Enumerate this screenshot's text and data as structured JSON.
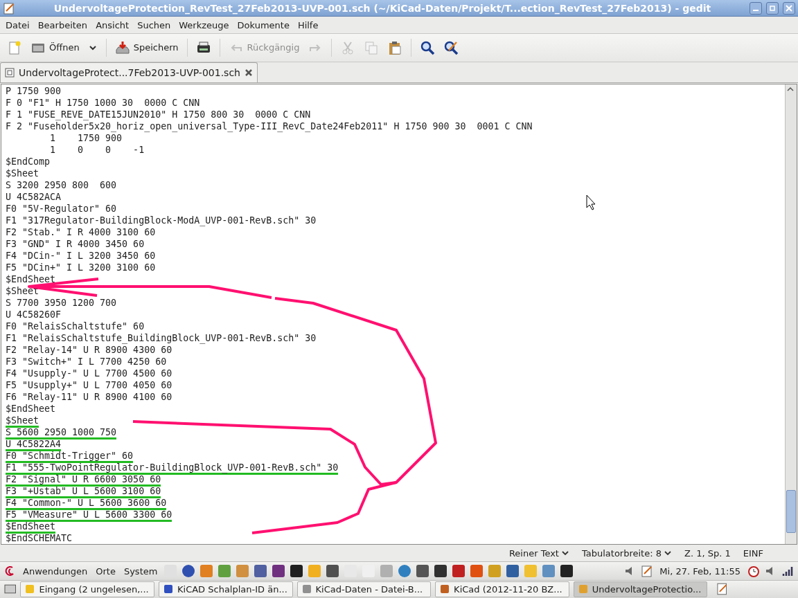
{
  "window": {
    "title": "UndervoltageProtection_RevTest_27Feb2013-UVP-001.sch (~/KiCad-Daten/Projekt/T...ection_RevTest_27Feb2013) - gedit"
  },
  "menu": [
    "Datei",
    "Bearbeiten",
    "Ansicht",
    "Suchen",
    "Werkzeuge",
    "Dokumente",
    "Hilfe"
  ],
  "toolbar": [
    {
      "kind": "new",
      "disabled": false
    },
    {
      "kind": "open",
      "label": "Öffnen",
      "disabled": false
    },
    {
      "kind": "dropdown",
      "disabled": false
    },
    {
      "kind": "sep"
    },
    {
      "kind": "save",
      "label": "Speichern",
      "disabled": false
    },
    {
      "kind": "sep"
    },
    {
      "kind": "print",
      "disabled": false
    },
    {
      "kind": "sep"
    },
    {
      "kind": "undo",
      "label": "Rückgängig",
      "disabled": true
    },
    {
      "kind": "redo",
      "disabled": true
    },
    {
      "kind": "sep"
    },
    {
      "kind": "cut",
      "disabled": true
    },
    {
      "kind": "copy",
      "disabled": true
    },
    {
      "kind": "paste",
      "disabled": false
    },
    {
      "kind": "sep"
    },
    {
      "kind": "search",
      "disabled": false
    },
    {
      "kind": "replace",
      "disabled": false
    }
  ],
  "tabs": [
    {
      "label": "UndervoltageProtect...7Feb2013-UVP-001.sch",
      "selected": true
    }
  ],
  "lines": [
    {
      "text": "P 1750 900",
      "underlined": false
    },
    {
      "text": "F 0 \"F1\" H 1750 1000 30  0000 C CNN",
      "underlined": false
    },
    {
      "text": "F 1 \"FUSE_REVE_DATE15JUN2010\" H 1750 800 30  0000 C CNN",
      "underlined": false
    },
    {
      "text": "F 2 \"Fuseholder5x20_horiz_open_universal_Type-III_RevC_Date24Feb2011\" H 1750 900 30  0001 C CNN",
      "underlined": false
    },
    {
      "text": "        1    1750 900",
      "underlined": false
    },
    {
      "text": "        1    0    0    -1",
      "underlined": false
    },
    {
      "text": "$EndComp",
      "underlined": false
    },
    {
      "text": "$Sheet",
      "underlined": false
    },
    {
      "text": "S 3200 2950 800  600",
      "underlined": false
    },
    {
      "text": "U 4C582ACA",
      "underlined": false
    },
    {
      "text": "F0 \"5V-Regulator\" 60",
      "underlined": false
    },
    {
      "text": "F1 \"317Regulator-BuildingBlock-ModA_UVP-001-RevB.sch\" 30",
      "underlined": false
    },
    {
      "text": "F2 \"Stab.\" I R 4000 3100 60",
      "underlined": false
    },
    {
      "text": "F3 \"GND\" I R 4000 3450 60",
      "underlined": false
    },
    {
      "text": "F4 \"DCin-\" I L 3200 3450 60",
      "underlined": false
    },
    {
      "text": "F5 \"DCin+\" I L 3200 3100 60",
      "underlined": false
    },
    {
      "text": "$EndSheet",
      "underlined": false
    },
    {
      "text": "$Sheet",
      "underlined": false
    },
    {
      "text": "S 7700 3950 1200 700",
      "underlined": false
    },
    {
      "text": "U 4C58260F",
      "underlined": false
    },
    {
      "text": "F0 \"RelaisSchaltstufe\" 60",
      "underlined": false
    },
    {
      "text": "F1 \"RelaisSchaltstufe_BuildingBlock_UVP-001-RevB.sch\" 30",
      "underlined": false
    },
    {
      "text": "F2 \"Relay-14\" U R 8900 4300 60",
      "underlined": false
    },
    {
      "text": "F3 \"Switch+\" I L 7700 4250 60",
      "underlined": false
    },
    {
      "text": "F4 \"Usupply-\" U L 7700 4500 60",
      "underlined": false
    },
    {
      "text": "F5 \"Usupply+\" U L 7700 4050 60",
      "underlined": false
    },
    {
      "text": "F6 \"Relay-11\" U R 8900 4100 60",
      "underlined": false
    },
    {
      "text": "$EndSheet",
      "underlined": false
    },
    {
      "text": "$Sheet",
      "underlined": true
    },
    {
      "text": "S 5600 2950 1000 750",
      "underlined": true
    },
    {
      "text": "U 4C5822A4",
      "underlined": true
    },
    {
      "text": "F0 \"Schmidt-Trigger\" 60",
      "underlined": true
    },
    {
      "text": "F1 \"555-TwoPointRegulator-BuildingBlock_UVP-001-RevB.sch\" 30",
      "underlined": true
    },
    {
      "text": "F2 \"Signal\" U R 6600 3050 60",
      "underlined": true
    },
    {
      "text": "F3 \"+Ustab\" U L 5600 3100 60",
      "underlined": true
    },
    {
      "text": "F4 \"Common-\" U L 5600 3600 60",
      "underlined": true
    },
    {
      "text": "F5 \"VMeasure\" U L 5600 3300 60",
      "underlined": true
    },
    {
      "text": "$EndSheet",
      "underlined": true
    },
    {
      "text": "$EndSCHEMATC",
      "underlined": false
    }
  ],
  "status_bar": [
    {
      "kind": "dropdown",
      "label": "Reiner Text"
    },
    {
      "kind": "dropdown",
      "label": "Tabulatorbreite: 8"
    },
    {
      "kind": "text",
      "label": "Z. 1, Sp. 1"
    },
    {
      "kind": "text",
      "label": "EINF"
    }
  ],
  "top_panel": {
    "menus": [
      "Anwendungen",
      "Orte",
      "System"
    ],
    "clock": "Mi, 27. Feb, 11:55"
  },
  "taskbar": [
    {
      "label": "Eingang (2 ungelesen,...",
      "selected": false,
      "color": "#f0c020"
    },
    {
      "label": "KiCAD Schalplan-ID än...",
      "selected": false,
      "color": "#3050c0"
    },
    {
      "label": "KiCad-Daten - Datei-B...",
      "selected": false,
      "color": "#909090"
    },
    {
      "label": "KiCad (2012-11-20 BZ...",
      "selected": false,
      "color": "#c06020"
    },
    {
      "label": "UndervoltageProtectio...",
      "selected": true,
      "color": "#e0a030"
    }
  ]
}
